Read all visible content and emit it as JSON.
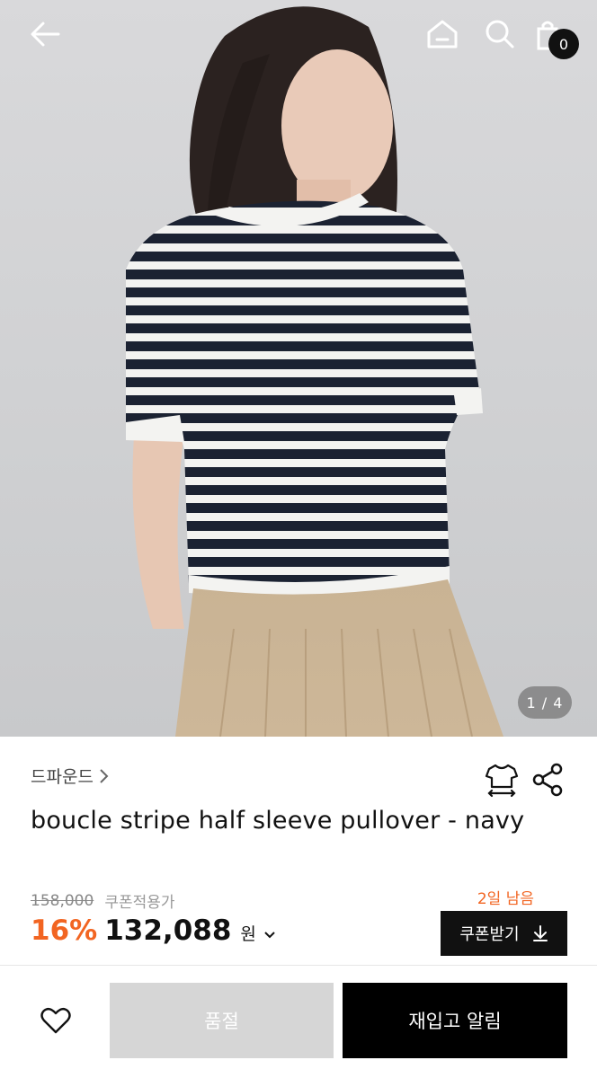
{
  "header": {
    "cart_count": "0",
    "icons": [
      "back-arrow-icon",
      "home-icon",
      "search-icon",
      "shopping-bag-icon"
    ]
  },
  "gallery": {
    "indicator": "1 / 4"
  },
  "product": {
    "brand": "드파운드",
    "title": "boucle stripe half sleeve pullover - navy",
    "original_price": "158,000",
    "coupon_note": "쿠폰적용가",
    "discount": "16%",
    "sale_price": "132,088",
    "currency": "원",
    "days_left": "2일 남음",
    "coupon_button": "쿠폰받기"
  },
  "actions": {
    "soldout_label": "품절",
    "restock_label": "재입고 알림"
  },
  "colors": {
    "accent": "#f26522",
    "primary_button": "#000000",
    "disabled_button": "#d6d6d6"
  }
}
